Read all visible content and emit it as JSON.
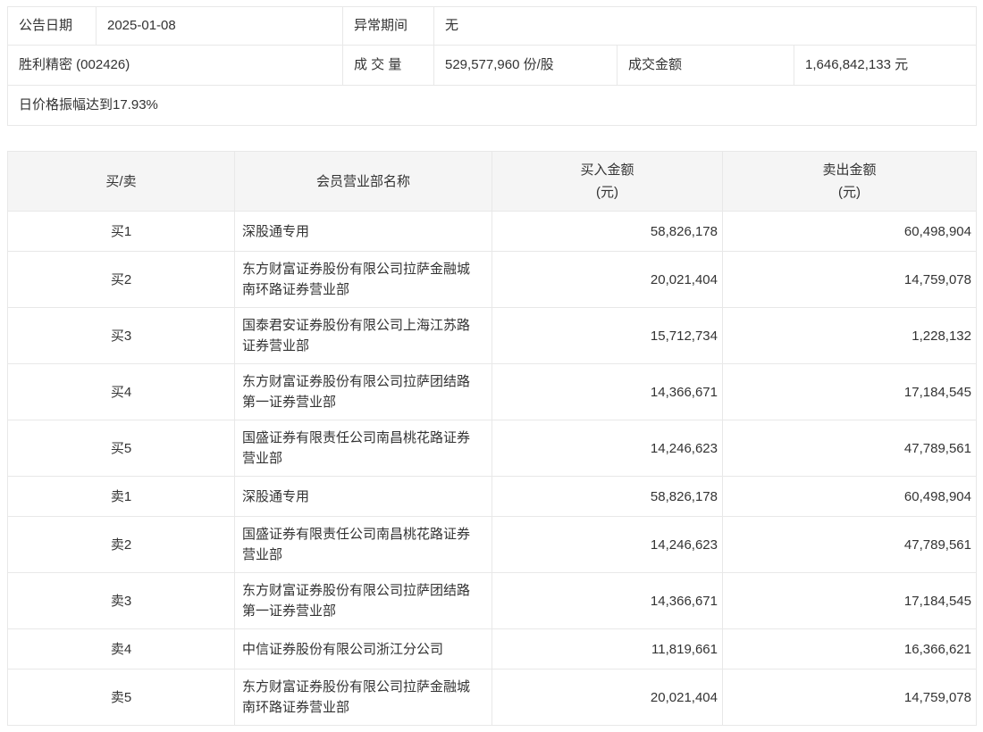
{
  "info": {
    "announce_date_label": "公告日期",
    "announce_date": "2025-01-08",
    "abnormal_period_label": "异常期间",
    "abnormal_period": "无",
    "stock_name": "胜利精密 (002426)",
    "volume_label": "成 交 量",
    "volume": "529,577,960 份/股",
    "turnover_label": "成交金额",
    "turnover": "1,646,842,133 元",
    "note": "日价格振幅达到17.93%"
  },
  "seats_table": {
    "columns": [
      "买/卖",
      "会员营业部名称",
      "买入金额\n(元)",
      "卖出金额\n(元)"
    ],
    "rows": [
      {
        "side": "买1",
        "branch": "深股通专用",
        "buy": "58,826,178",
        "sell": "60,498,904"
      },
      {
        "side": "买2",
        "branch": "东方财富证券股份有限公司拉萨金融城南环路证券营业部",
        "buy": "20,021,404",
        "sell": "14,759,078"
      },
      {
        "side": "买3",
        "branch": "国泰君安证券股份有限公司上海江苏路证券营业部",
        "buy": "15,712,734",
        "sell": "1,228,132"
      },
      {
        "side": "买4",
        "branch": "东方财富证券股份有限公司拉萨团结路第一证券营业部",
        "buy": "14,366,671",
        "sell": "17,184,545"
      },
      {
        "side": "买5",
        "branch": "国盛证券有限责任公司南昌桃花路证券营业部",
        "buy": "14,246,623",
        "sell": "47,789,561"
      },
      {
        "side": "卖1",
        "branch": "深股通专用",
        "buy": "58,826,178",
        "sell": "60,498,904"
      },
      {
        "side": "卖2",
        "branch": "国盛证券有限责任公司南昌桃花路证券营业部",
        "buy": "14,246,623",
        "sell": "47,789,561"
      },
      {
        "side": "卖3",
        "branch": "东方财富证券股份有限公司拉萨团结路第一证券营业部",
        "buy": "14,366,671",
        "sell": "17,184,545"
      },
      {
        "side": "卖4",
        "branch": "中信证券股份有限公司浙江分公司",
        "buy": "11,819,661",
        "sell": "16,366,621"
      },
      {
        "side": "卖5",
        "branch": "东方财富证券股份有限公司拉萨金融城南环路证券营业部",
        "buy": "20,021,404",
        "sell": "14,759,078"
      }
    ]
  },
  "colors": {
    "border": "#e8e8e8",
    "header_bg": "#f5f5f5",
    "text": "#333333"
  }
}
